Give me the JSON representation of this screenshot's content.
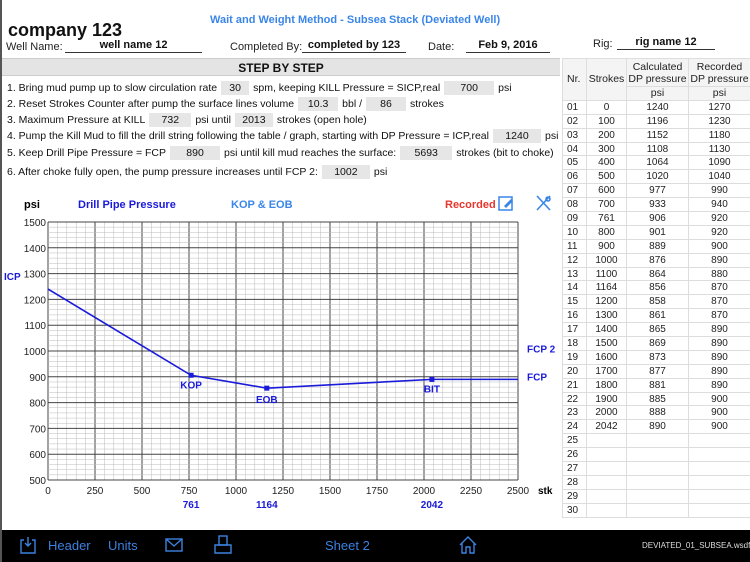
{
  "company": "company 123",
  "title": "Wait and Weight Method - Subsea Stack (Deviated Well)",
  "header": {
    "well_name_label": "Well Name:",
    "well_name": "well name 12",
    "completed_by_label": "Completed By:",
    "completed_by": "completed by 123",
    "date_label": "Date:",
    "date": "Feb 9, 2016",
    "rig_label": "Rig:",
    "rig": "rig name 12"
  },
  "steps_title": "STEP BY STEP",
  "steps": [
    {
      "t1": "1. Bring mud pump up to slow circulation rate",
      "v1": "30",
      "t2": "spm,  keeping KILL Pressure = SICP,real",
      "v2": "700",
      "t3": "psi"
    },
    {
      "t1": "2. Reset Strokes Counter after pump the surface lines volume",
      "v1": "10.3",
      "t2": "bbl      /",
      "v2": "86",
      "t3": "strokes"
    },
    {
      "t1": "3. Maximum Pressure at KILL",
      "v1": "732",
      "t2": "psi     until",
      "v2": "2013",
      "t3": "strokes (open hole)"
    },
    {
      "t1": "4. Pump the Kill Mud to fill the drill string following the table / graph, starting with DP Pressure = ICP,real",
      "v1": "1240",
      "t2": "psi"
    },
    {
      "t1": "5. Keep Drill Pipe Pressure = FCP",
      "v1": "890",
      "t2": "psi    until kill mud reaches the surface:",
      "v2": "5693",
      "t3": "strokes (bit to choke)"
    },
    {
      "t1": "6. After choke fully open, the pump pressure increases until FCP 2:",
      "v1": "1002",
      "t2": "psi"
    }
  ],
  "chart_data": {
    "type": "line",
    "ylabel": "psi",
    "xlabel": "stk",
    "legend": {
      "drill_pipe": "Drill Pipe Pressure",
      "kop_eob": "KOP & EOB",
      "recorded": "Recorded"
    },
    "xlim": [
      0,
      2500
    ],
    "ylim": [
      500,
      1500
    ],
    "x_ticks": [
      0,
      250,
      500,
      750,
      1000,
      1250,
      1500,
      1750,
      2000,
      2250,
      2500
    ],
    "y_ticks": [
      500,
      600,
      700,
      800,
      900,
      1000,
      1100,
      1200,
      1300,
      1400,
      1500
    ],
    "grid": true,
    "series": [
      {
        "name": "Drill Pipe Pressure",
        "x": [
          0,
          761,
          1164,
          2042,
          2500
        ],
        "y": [
          1240,
          906,
          856,
          890,
          890
        ]
      }
    ],
    "markers": [
      {
        "label": "KOP",
        "x": 761,
        "y": 906
      },
      {
        "label": "EOB",
        "x": 1164,
        "y": 856
      },
      {
        "label": "BIT",
        "x": 2042,
        "y": 890
      }
    ],
    "marker_x_labels": [
      "761",
      "1164",
      "2042"
    ],
    "side_labels": {
      "icp": "ICP",
      "icp_value": 1240,
      "fcp": "FCP",
      "fcp_value": 890,
      "fcp2": "FCP 2",
      "fcp2_value": 1002
    },
    "colors": {
      "line": "#1a1adb",
      "kop": "#3a86e8",
      "recorded": "#e8352d"
    }
  },
  "table": {
    "headers": {
      "nr": "Nr.",
      "strokes": "Strokes",
      "calc": "Calculated DP pressure",
      "rec": "Recorded DP pressure",
      "unit": "psi"
    },
    "rows": [
      [
        "01",
        "0",
        "1240",
        "1270"
      ],
      [
        "02",
        "100",
        "1196",
        "1230"
      ],
      [
        "03",
        "200",
        "1152",
        "1180"
      ],
      [
        "04",
        "300",
        "1108",
        "1130"
      ],
      [
        "05",
        "400",
        "1064",
        "1090"
      ],
      [
        "06",
        "500",
        "1020",
        "1040"
      ],
      [
        "07",
        "600",
        "977",
        "990"
      ],
      [
        "08",
        "700",
        "933",
        "940"
      ],
      [
        "09",
        "761",
        "906",
        "920"
      ],
      [
        "10",
        "800",
        "901",
        "920"
      ],
      [
        "11",
        "900",
        "889",
        "900"
      ],
      [
        "12",
        "1000",
        "876",
        "890"
      ],
      [
        "13",
        "1100",
        "864",
        "880"
      ],
      [
        "14",
        "1164",
        "856",
        "870"
      ],
      [
        "15",
        "1200",
        "858",
        "870"
      ],
      [
        "16",
        "1300",
        "861",
        "870"
      ],
      [
        "17",
        "1400",
        "865",
        "890"
      ],
      [
        "18",
        "1500",
        "869",
        "890"
      ],
      [
        "19",
        "1600",
        "873",
        "890"
      ],
      [
        "20",
        "1700",
        "877",
        "890"
      ],
      [
        "21",
        "1800",
        "881",
        "890"
      ],
      [
        "22",
        "1900",
        "885",
        "900"
      ],
      [
        "23",
        "2000",
        "888",
        "900"
      ],
      [
        "24",
        "2042",
        "890",
        "900"
      ],
      [
        "25",
        "",
        "",
        ""
      ],
      [
        "26",
        "",
        "",
        ""
      ],
      [
        "27",
        "",
        "",
        ""
      ],
      [
        "28",
        "",
        "",
        ""
      ],
      [
        "29",
        "",
        "",
        ""
      ],
      [
        "30",
        "",
        "",
        ""
      ]
    ]
  },
  "footer": {
    "header": "Header",
    "units": "Units",
    "sheet": "Sheet 2",
    "file": "DEVIATED_01_SUBSEA.wsdf"
  }
}
